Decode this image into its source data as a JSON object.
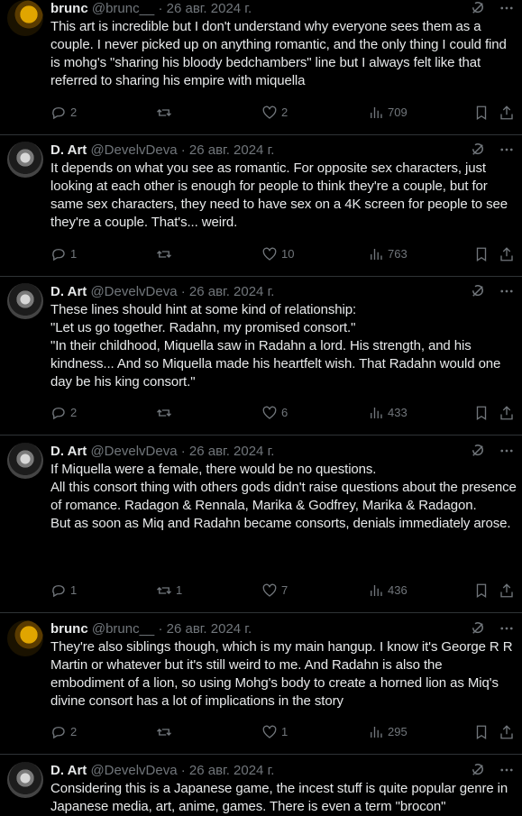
{
  "tweets": [
    {
      "name": "brunc",
      "handle": "@brunc__",
      "date": "26 авг. 2024 г.",
      "text": "This art is incredible but I don't understand why everyone sees them as a couple. I never picked up on anything romantic, and the only thing I could find is mohg's \"sharing his bloody bedchambers\" line but I always felt like that referred to sharing his empire with miquella",
      "replies": "2",
      "reposts": "",
      "likes": "2",
      "views": "709",
      "avatar": "brunc"
    },
    {
      "name": "D. Art",
      "handle": "@DevelvDeva",
      "date": "26 авг. 2024 г.",
      "text": "It depends on what you see as romantic. For opposite sex characters, just looking at each other is enough for people to think they're a couple, but for same sex characters, they need to have sex on a 4K screen for people to see they're a couple. That's... weird.",
      "replies": "1",
      "reposts": "",
      "likes": "10",
      "views": "763",
      "avatar": "dart"
    },
    {
      "name": "D. Art",
      "handle": "@DevelvDeva",
      "date": "26 авг. 2024 г.",
      "text": "These lines should hint at some kind of relationship:\n\"Let us go together. Radahn, my promised consort.\"\n\"In their childhood, Miquella saw in Radahn a lord. His strength, and his kindness... And so Miquella made his heartfelt wish. That Radahn would one day be his king consort.\"",
      "replies": "2",
      "reposts": "",
      "likes": "6",
      "views": "433",
      "avatar": "dart"
    },
    {
      "name": "D. Art",
      "handle": "@DevelvDeva",
      "date": "26 авг. 2024 г.",
      "text": "If Miquella were a female, there would be no questions.\nAll this consort thing with others gods didn't raise questions about the presence of romance. Radagon & Rennala, Marika & Godfrey, Marika & Radagon.\nBut as soon as Miq and Radahn became consorts, denials immediately arose.",
      "replies": "1",
      "reposts": "1",
      "likes": "7",
      "views": "436",
      "avatar": "dart"
    },
    {
      "name": "brunc",
      "handle": "@brunc__",
      "date": "26 авг. 2024 г.",
      "text": "They're also siblings though, which is my main hangup. I know it's George R R Martin or whatever but it's still weird to me. And Radahn is also the embodiment of a lion, so using Mohg's body to create a horned lion as Miq's divine consort has a lot of implications in the story",
      "replies": "2",
      "reposts": "",
      "likes": "1",
      "views": "295",
      "avatar": "brunc"
    },
    {
      "name": "D. Art",
      "handle": "@DevelvDeva",
      "date": "26 авг. 2024 г.",
      "text": "Considering this is a Japanese game, the incest stuff is quite popular genre in Japanese media, art, anime, games. There is even a term \"brocon\"",
      "replies": "",
      "reposts": "",
      "likes": "",
      "views": "",
      "avatar": "dart"
    }
  ],
  "colors": {
    "background": "#000000",
    "text": "#e7e9ea",
    "muted": "#71767b",
    "separator": "#2f3336"
  },
  "icons": [
    "grok-icon",
    "more-icon",
    "reply-icon",
    "repost-icon",
    "like-icon",
    "views-icon",
    "bookmark-icon",
    "share-icon"
  ]
}
